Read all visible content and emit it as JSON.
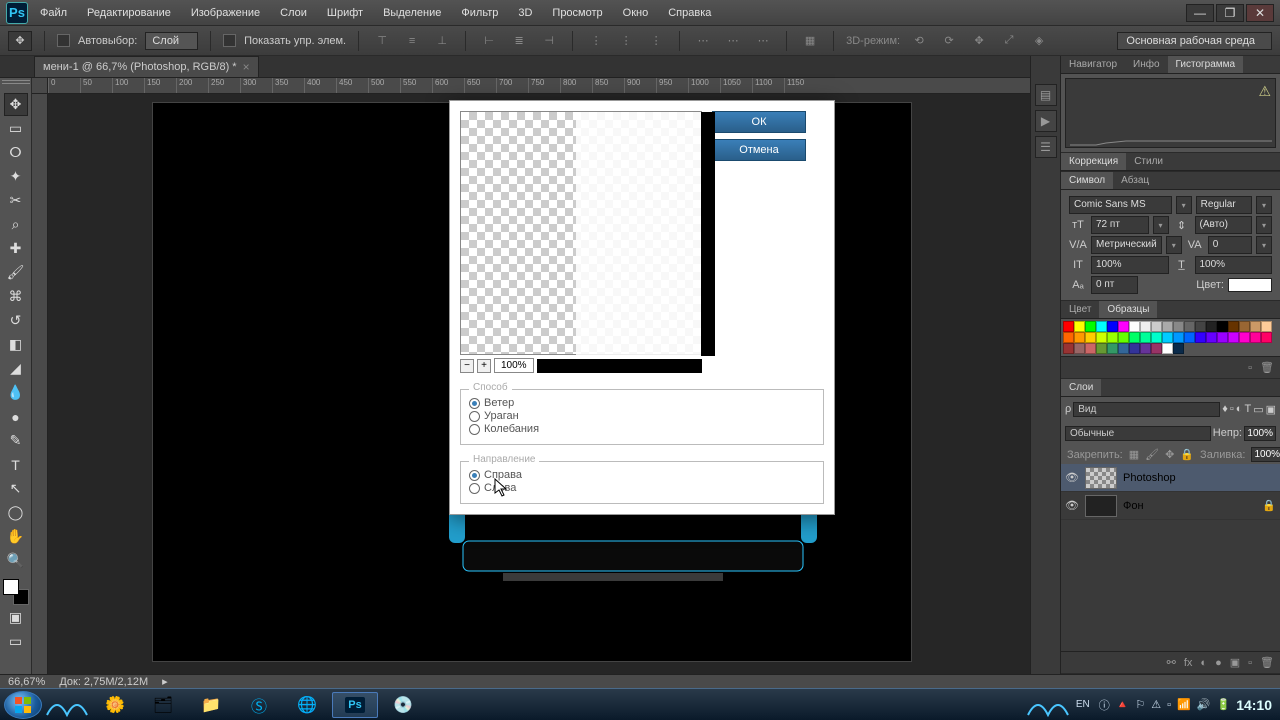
{
  "menubar": {
    "items": [
      "Файл",
      "Редактирование",
      "Изображение",
      "Слои",
      "Шрифт",
      "Выделение",
      "Фильтр",
      "3D",
      "Просмотр",
      "Окно",
      "Справка"
    ]
  },
  "optionsbar": {
    "autoselect_label": "Автовыбор:",
    "autoselect_value": "Слой",
    "show_controls_label": "Показать упр. элем.",
    "mode_3d": "3D-режим:",
    "workspace": "Основная рабочая среда"
  },
  "document": {
    "tab_title": "мени-1 @ 66,7% (Photoshop, RGB/8) *",
    "ruler_labels": [
      "0",
      "50",
      "100",
      "150",
      "200",
      "250",
      "300",
      "350",
      "400",
      "450",
      "500",
      "550",
      "600",
      "650",
      "700",
      "750",
      "800",
      "850",
      "900",
      "950",
      "1000",
      "1050",
      "1100",
      "1150"
    ]
  },
  "panels": {
    "nav_tabs": [
      "Навигатор",
      "Инфо",
      "Гистограмма"
    ],
    "corr_tabs": [
      "Коррекция",
      "Стили"
    ],
    "char_tabs": [
      "Символ",
      "Абзац"
    ],
    "color_tabs": [
      "Цвет",
      "Образцы"
    ],
    "layer_tab": "Слои"
  },
  "character": {
    "font": "Comic Sans MS",
    "style": "Regular",
    "size": "72 пт",
    "leading": "(Авто)",
    "kerning": "Метрический",
    "tracking": "0",
    "vscale": "100%",
    "hscale": "100%",
    "baseline": "0 пт",
    "color_label": "Цвет:"
  },
  "swatches_colors": [
    "#ff0000",
    "#ffff00",
    "#00ff00",
    "#00ffff",
    "#0000ff",
    "#ff00ff",
    "#ffffff",
    "#eeeeee",
    "#cccccc",
    "#aaaaaa",
    "#888888",
    "#666666",
    "#444444",
    "#222222",
    "#000000",
    "#663300",
    "#996633",
    "#cc9966",
    "#ffcc99",
    "#ff6600",
    "#ff9900",
    "#ffcc00",
    "#ccff00",
    "#99ff00",
    "#66ff00",
    "#00ff66",
    "#00ff99",
    "#00ffcc",
    "#00ccff",
    "#0099ff",
    "#0066ff",
    "#3300ff",
    "#6600ff",
    "#9900ff",
    "#cc00ff",
    "#ff00cc",
    "#ff0099",
    "#ff0066",
    "#993333",
    "#996666",
    "#cc6666",
    "#669933",
    "#339966",
    "#336699",
    "#333399",
    "#663399",
    "#993366",
    "#ffffff",
    "#0a2a4a"
  ],
  "layers": {
    "kind_label": "Вид",
    "blend": "Обычные",
    "opacity_label": "Непр:",
    "opacity": "100%",
    "lock_label": "Закрепить:",
    "fill_label": "Заливка:",
    "fill": "100%",
    "items": [
      {
        "name": "Photoshop",
        "locked": false,
        "checker": true
      },
      {
        "name": "Фон",
        "locked": true,
        "checker": false
      }
    ]
  },
  "statusbar": {
    "zoom": "66,67%",
    "doc": "Док: 2,75M/2,12M"
  },
  "dialog": {
    "ok": "ОК",
    "cancel": "Отмена",
    "zoom": "100%",
    "fieldset1_legend": "Способ",
    "methods": [
      "Ветер",
      "Ураган",
      "Колебания"
    ],
    "method_selected": 0,
    "fieldset2_legend": "Направление",
    "directions": [
      "Справа",
      "Слева"
    ],
    "direction_selected": 0
  },
  "taskbar": {
    "lang": "EN",
    "clock": "14:10"
  }
}
